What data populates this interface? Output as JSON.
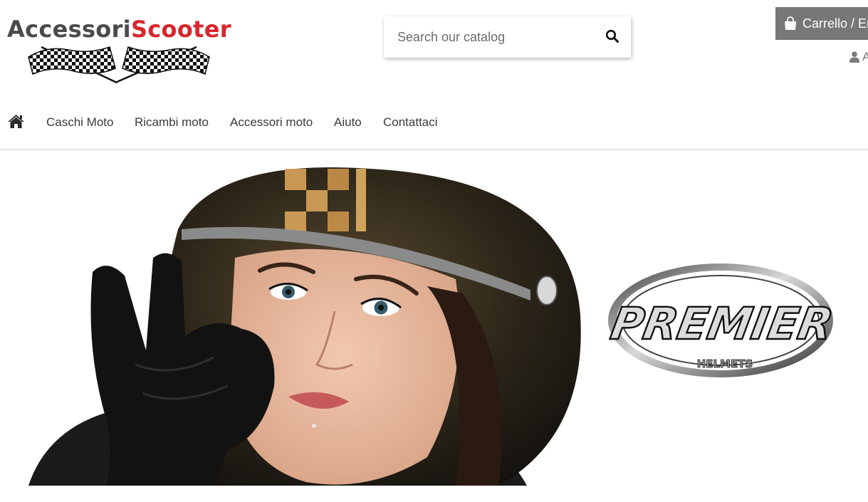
{
  "logo": {
    "part1": "Accessori",
    "part2": "Scooter"
  },
  "search": {
    "placeholder": "Search our catalog"
  },
  "cart": {
    "label": "Carrello / Em"
  },
  "account": {
    "label": "Ac"
  },
  "nav": {
    "items": [
      {
        "label": "Caschi Moto"
      },
      {
        "label": "Ricambi moto"
      },
      {
        "label": "Accessori moto"
      },
      {
        "label": "Aiuto"
      },
      {
        "label": "Contattaci"
      }
    ]
  },
  "banner": {
    "brand": "PREMIER",
    "brand_sub": "HELMETS"
  },
  "icons": {
    "search": "search-icon",
    "cart": "shopping-bag-icon",
    "account": "user-icon",
    "home": "home-icon",
    "logo": "checkered-flags-icon"
  },
  "colors": {
    "brand_red": "#d8262c",
    "cart_bg": "#777777",
    "text": "#333333"
  }
}
